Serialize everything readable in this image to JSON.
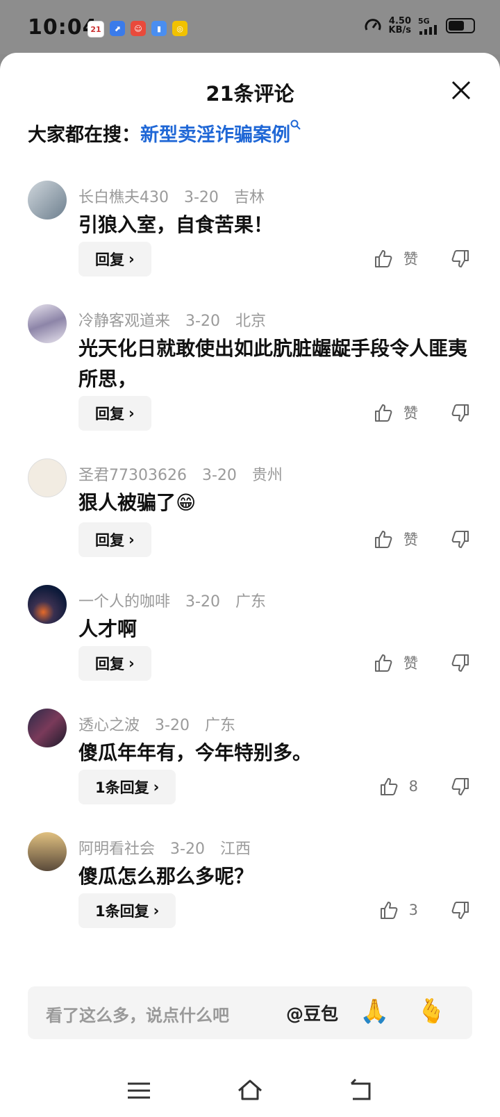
{
  "status_bar": {
    "time": "10:04",
    "calendar_day": "21",
    "speed_value": "4.50",
    "speed_unit": "KB/s",
    "network": "5G"
  },
  "sheet": {
    "title": "21条评论",
    "trending_prefix": "大家都在搜：",
    "trending_link": "新型卖淫诈骗案例"
  },
  "comments": [
    {
      "user": "长白樵夫430",
      "date": "3-20",
      "location": "吉林",
      "text": "引狼入室，自食苦果！",
      "reply_label": "回复",
      "like_label": "赞"
    },
    {
      "user": "冷静客观道来",
      "date": "3-20",
      "location": "北京",
      "text": "光天化日就敢使出如此肮脏龌龊手段令人匪夷所思，",
      "reply_label": "回复",
      "like_label": "赞"
    },
    {
      "user": "圣君77303626",
      "date": "3-20",
      "location": "贵州",
      "text": "狠人被骗了😁",
      "reply_label": "回复",
      "like_label": "赞"
    },
    {
      "user": "一个人的咖啡",
      "date": "3-20",
      "location": "广东",
      "text": "人才啊",
      "reply_label": "回复",
      "like_label": "赞"
    },
    {
      "user": "透心之波",
      "date": "3-20",
      "location": "广东",
      "text": "傻瓜年年有，今年特别多。",
      "reply_label": "1条回复",
      "like_label": "8"
    },
    {
      "user": "阿明看社会",
      "date": "3-20",
      "location": "江西",
      "text": "傻瓜怎么那么多呢？",
      "reply_label": "1条回复",
      "like_label": "3"
    }
  ],
  "input": {
    "placeholder": "看了这么多，说点什么吧",
    "mention": "@豆包",
    "emoji_1": "🙏",
    "emoji_2": "🫰"
  },
  "colors": {
    "link": "#1f67d6",
    "meta_text": "#9a9a9a",
    "reply_bg": "#f3f3f3"
  }
}
